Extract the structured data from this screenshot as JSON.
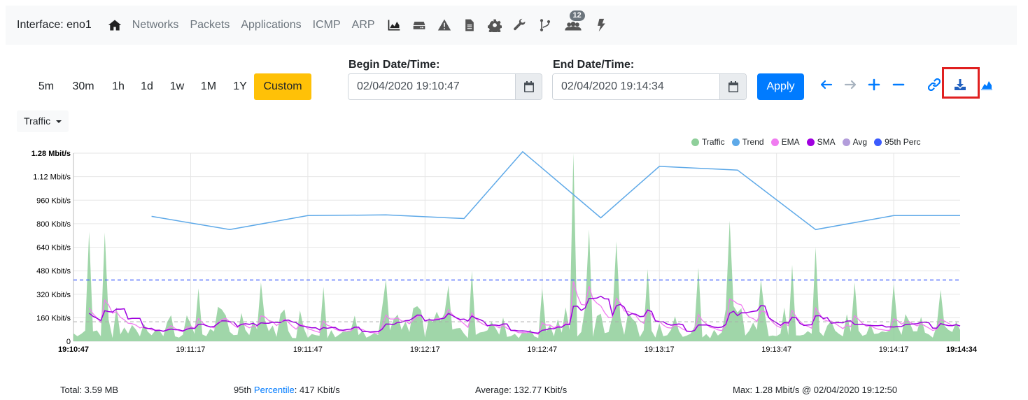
{
  "navbar": {
    "title": "Interface: eno1",
    "links": [
      "Networks",
      "Packets",
      "Applications",
      "ICMP",
      "ARP"
    ],
    "icons": [
      "home-icon",
      "area-chart-icon",
      "hdd-icon",
      "warning-icon",
      "file-icon",
      "gear-icon",
      "wrench-icon",
      "code-branch-icon",
      "users-icon",
      "bolt-icon"
    ],
    "users_badge": "12"
  },
  "ranges": [
    "5m",
    "30m",
    "1h",
    "1d",
    "1w",
    "1M",
    "1Y",
    "Custom"
  ],
  "active_range": "Custom",
  "begin": {
    "label": "Begin Date/Time:",
    "value": "02/04/2020 19:10:47"
  },
  "end": {
    "label": "End Date/Time:",
    "value": "02/04/2020 19:14:34"
  },
  "apply_label": "Apply",
  "toolbar_icons": [
    "arrow-left-icon",
    "arrow-right-icon",
    "plus-icon",
    "minus-icon",
    "link-icon",
    "download-icon",
    "area-chart-icon"
  ],
  "metric_dropdown": "Traffic",
  "colors": {
    "traffic": "#8fcf9a",
    "trend": "#5ea9e8",
    "ema": "#f07cf0",
    "sma": "#a000e0",
    "avg": "#b39ddb",
    "perc95": "#3b5bfd",
    "accent": "#007bff",
    "active": "#ffc107",
    "highlight": "#e02020"
  },
  "chart_data": {
    "type": "area",
    "legend": [
      "Traffic",
      "Trend",
      "EMA",
      "SMA",
      "Avg",
      "95th Perc"
    ],
    "y_ticks": [
      "0",
      "160 Kbit/s",
      "320 Kbit/s",
      "480 Kbit/s",
      "640 Kbit/s",
      "800 Kbit/s",
      "960 Kbit/s",
      "1.12 Mbit/s",
      "1.28 Mbit/s"
    ],
    "y_max_kbit": 1280,
    "x_ticks": [
      "19:10:47",
      "19:11:17",
      "19:11:47",
      "19:12:17",
      "19:12:47",
      "19:13:17",
      "19:13:47",
      "19:14:17",
      "19:14:34"
    ],
    "x_range_sec": [
      0,
      227
    ],
    "avg_kbit": 132.77,
    "perc95_kbit": 417,
    "trend": [
      [
        20,
        850
      ],
      [
        40,
        760
      ],
      [
        60,
        855
      ],
      [
        80,
        860
      ],
      [
        100,
        835
      ],
      [
        115,
        1290
      ],
      [
        135,
        840
      ],
      [
        150,
        1190
      ],
      [
        170,
        1165
      ],
      [
        190,
        760
      ],
      [
        210,
        855
      ],
      [
        227,
        855
      ]
    ],
    "traffic_peaks": [
      [
        4,
        745
      ],
      [
        8,
        740
      ],
      [
        32,
        360
      ],
      [
        48,
        400
      ],
      [
        64,
        370
      ],
      [
        80,
        420
      ],
      [
        96,
        380
      ],
      [
        102,
        480
      ],
      [
        120,
        360
      ],
      [
        128,
        1280
      ],
      [
        132,
        760
      ],
      [
        139,
        680
      ],
      [
        147,
        490
      ],
      [
        160,
        500
      ],
      [
        168,
        820
      ],
      [
        176,
        420
      ],
      [
        184,
        520
      ],
      [
        190,
        640
      ],
      [
        200,
        400
      ],
      [
        210,
        390
      ],
      [
        222,
        350
      ]
    ]
  },
  "footer": {
    "total": "Total: 3.59 MB",
    "perc_prefix": "95th ",
    "perc_link": "Percentile",
    "perc_suffix": ": 417 Kbit/s",
    "average": "Average: 132.77 Kbit/s",
    "max": "Max: 1.28 Mbit/s @ 02/04/2020 19:12:50"
  }
}
